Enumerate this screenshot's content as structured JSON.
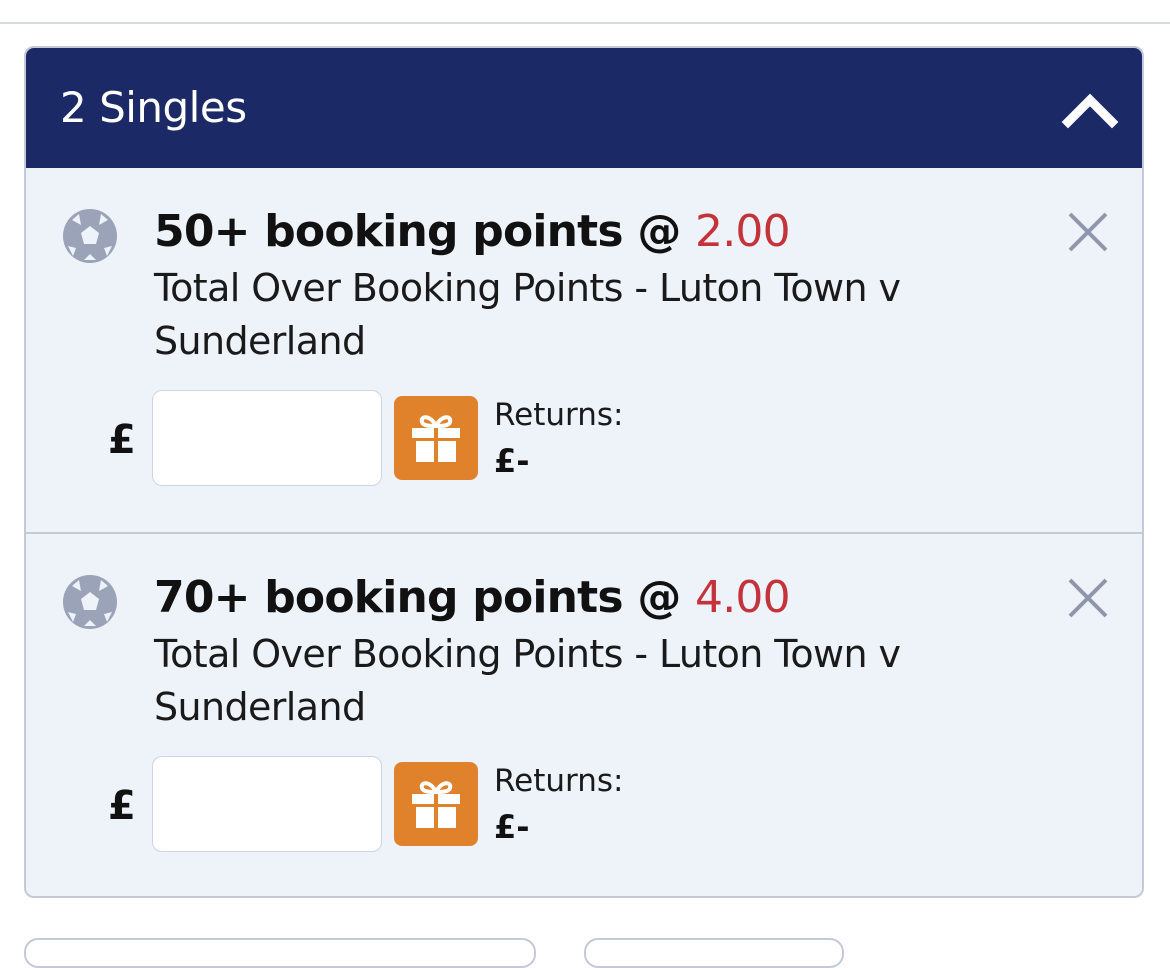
{
  "betslip": {
    "title": "2 Singles",
    "bets": [
      {
        "selection": "50+ booking points @ ",
        "odds": "2.00",
        "market": "Total Over Booking Points - Luton Town v Sunderland",
        "currency": "£",
        "stake": "",
        "returns_label": "Returns:",
        "returns_value": "£-",
        "sport_icon": "football-icon",
        "remove_icon": "close-icon",
        "boost_icon": "gift-icon"
      },
      {
        "selection": "70+ booking points @ ",
        "odds": "4.00",
        "market": "Total Over Booking Points - Luton Town v Sunderland",
        "currency": "£",
        "stake": "",
        "returns_label": "Returns:",
        "returns_value": "£-",
        "sport_icon": "football-icon",
        "remove_icon": "close-icon",
        "boost_icon": "gift-icon"
      }
    ],
    "collapse_icon": "chevron-up-icon"
  },
  "colors": {
    "header_bg": "#1b2a67",
    "panel_bg": "#eef2f9",
    "odds": "#c5333a",
    "boost_bg": "#e0812c",
    "icon_grey": "#9aa3b8"
  }
}
